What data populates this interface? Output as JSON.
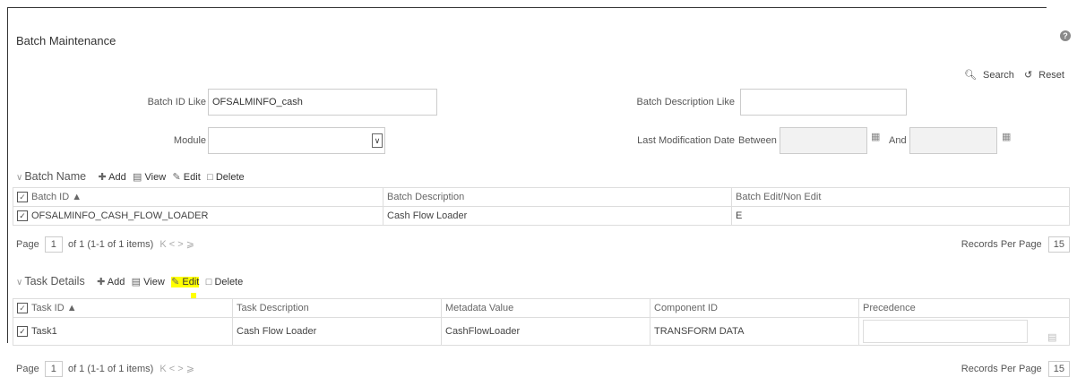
{
  "page": {
    "title": "Batch Maintenance",
    "help_glyph": "?"
  },
  "toolbar": {
    "search_label": "Search",
    "reset_label": "Reset",
    "search_icon": "search-icon",
    "reset_icon": "reset-icon"
  },
  "filters": {
    "batch_id_label": "Batch ID Like",
    "batch_id_value": "OFSALMINFO_cash",
    "batch_desc_label": "Batch Description Like",
    "batch_desc_value": "",
    "module_label": "Module",
    "module_value": "",
    "last_mod_label": "Last Modification Date",
    "between_label": "Between",
    "and_label": "And",
    "from_date": "",
    "to_date": ""
  },
  "batch_section": {
    "title": "Batch Name",
    "actions": {
      "add": "Add",
      "view": "View",
      "edit": "Edit",
      "delete": "Delete"
    },
    "columns": [
      "Batch ID",
      "Batch Description",
      "Batch Edit/Non Edit"
    ],
    "rows": [
      {
        "id": "OFSALMINFO_CASH_FLOW_LOADER",
        "description": "Cash Flow Loader",
        "edit": "E"
      }
    ],
    "pager": {
      "page_label": "Page",
      "page": "1",
      "summary": "of 1 (1-1 of 1 items)",
      "records_label": "Records Per Page",
      "records": "15"
    }
  },
  "task_section": {
    "title": "Task Details",
    "actions": {
      "add": "Add",
      "view": "View",
      "edit": "Edit",
      "delete": "Delete"
    },
    "columns": [
      "Task ID",
      "Task Description",
      "Metadata Value",
      "Component ID",
      "Precedence"
    ],
    "rows": [
      {
        "id": "Task1",
        "description": "Cash Flow Loader",
        "metadata": "CashFlowLoader",
        "component": "TRANSFORM DATA",
        "precedence": ""
      }
    ],
    "pager": {
      "page_label": "Page",
      "page": "1",
      "summary": "of 1 (1-1 of 1 items)",
      "records_label": "Records Per Page",
      "records": "15"
    }
  },
  "colors": {
    "highlight": "#ffff00"
  }
}
